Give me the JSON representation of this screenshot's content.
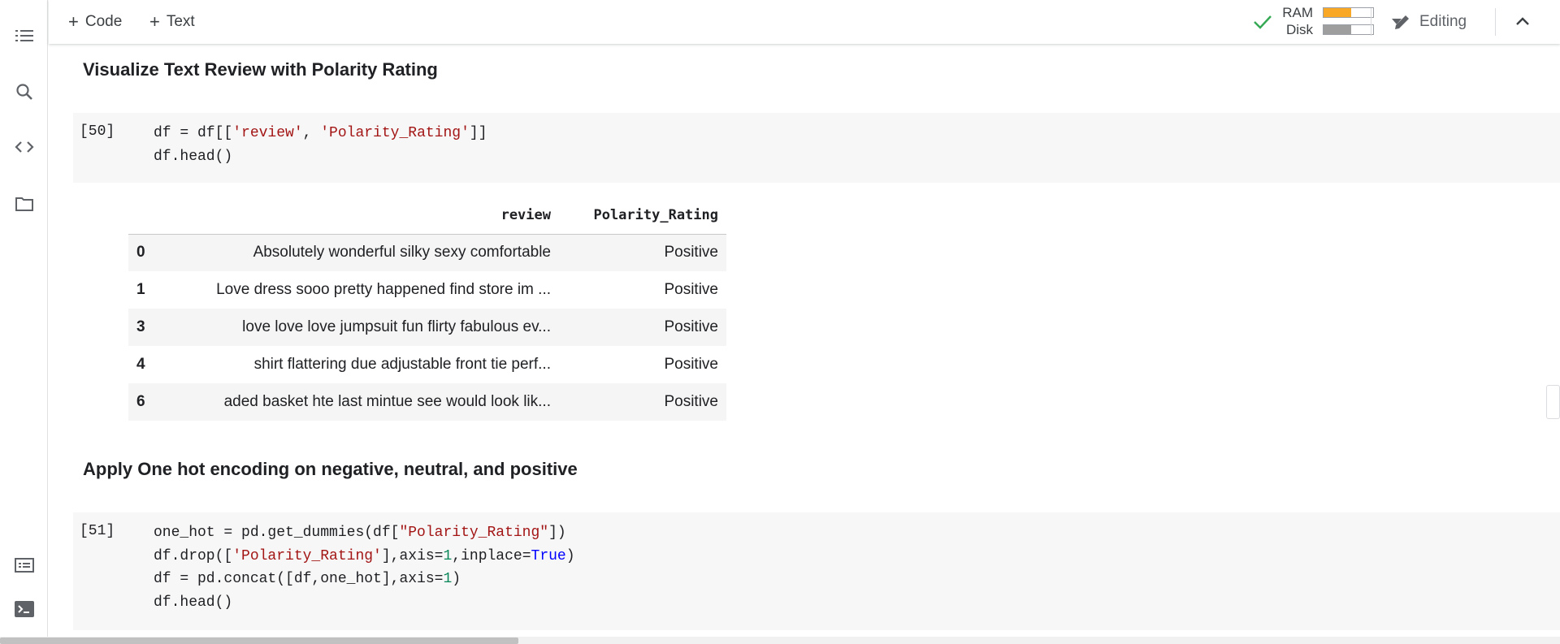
{
  "toolbar": {
    "add_code": "Code",
    "add_text": "Text",
    "ram_label": "RAM",
    "disk_label": "Disk",
    "ram_usage": 0.55,
    "disk_usage": 0.55,
    "ram_color": "#f9a825",
    "disk_color": "#9e9e9e",
    "connected_color": "#34a853",
    "editing_label": "Editing"
  },
  "rail": {
    "icons": [
      "table-of-contents-icon",
      "search-icon",
      "code-snippets-icon",
      "files-icon",
      "command-palette-icon",
      "terminal-icon"
    ]
  },
  "cells": {
    "heading1": "Visualize Text Review with Polarity Rating",
    "cell50": {
      "exec_count": "[50]",
      "line1_a": "df = df[[",
      "line1_s1": "'review'",
      "line1_b": ", ",
      "line1_s2": "'Polarity_Rating'",
      "line1_c": "]]",
      "line2": "df.head()"
    },
    "table": {
      "columns": [
        "review",
        "Polarity_Rating"
      ],
      "rows": [
        {
          "index": "0",
          "review": "Absolutely wonderful silky sexy comfortable",
          "polarity": "Positive"
        },
        {
          "index": "1",
          "review": "Love dress sooo pretty happened find store im ...",
          "polarity": "Positive"
        },
        {
          "index": "3",
          "review": "love love love jumpsuit fun flirty fabulous ev...",
          "polarity": "Positive"
        },
        {
          "index": "4",
          "review": "shirt flattering due adjustable front tie perf...",
          "polarity": "Positive"
        },
        {
          "index": "6",
          "review": "aded basket hte last mintue see would look lik...",
          "polarity": "Positive"
        }
      ]
    },
    "heading2": "Apply One hot encoding on negative, neutral, and positive",
    "cell51": {
      "exec_count": "[51]",
      "l1_a": "one_hot = pd.get_dummies(df[",
      "l1_s": "\"Polarity_Rating\"",
      "l1_b": "])",
      "l2_a": "df.drop([",
      "l2_s": "'Polarity_Rating'",
      "l2_b": "],axis=",
      "l2_n": "1",
      "l2_c": ",inplace=",
      "l2_k": "True",
      "l2_d": ")",
      "l3_a": "df = pd.concat([df,one_hot],axis=",
      "l3_n": "1",
      "l3_b": ")",
      "l4": "df.head()"
    }
  }
}
